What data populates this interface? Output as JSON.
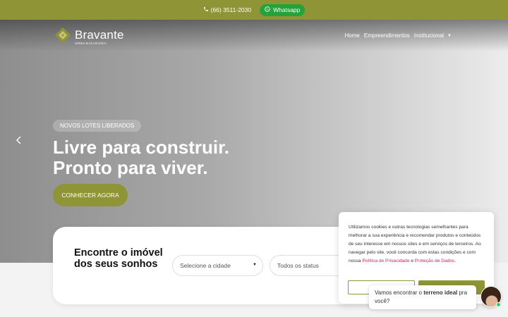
{
  "topbar": {
    "phone": "(66) 3511-2030",
    "whatsapp_label": "Whatsapp",
    "bg_color": "#8f9436",
    "whatsapp_color": "#24a33b"
  },
  "header": {
    "logo_name": "Bravante",
    "logo_sub": "URBANIZADORA",
    "nav": [
      {
        "label": "Home"
      },
      {
        "label": "Empreendimentos"
      },
      {
        "label": "Institucional"
      }
    ]
  },
  "hero": {
    "badge": "NOVOS LOTES LIBERADOS",
    "headline_line1": "Livre para construir.",
    "headline_line2": "Pronto para viver.",
    "cta_label": "CONHECER AGORA",
    "accent_color": "#8f9436"
  },
  "search": {
    "title": "Encontre o imóvel dos seus sonhos",
    "city_placeholder": "Selecione a cidade",
    "status_placeholder": "Todos os status"
  },
  "cookie": {
    "text_before": "Utilizamos cookies e outras tecnologias semelhantes para melhorar a sua experiência e recomendar produtos e conteúdos de seu interesse em nossos sites e em serviços de terceiros. Ao navegar pelo site, você concorda com estas condições e com nossa ",
    "privacy_link": "Política de Privacidade",
    "conjunction": " e ",
    "data_link": "Proteção de Dados",
    "text_after": ".",
    "link_color": "#d4236c"
  },
  "chat": {
    "text_before": "Vamos encontrar o ",
    "text_bold": "terreno ideal",
    "text_after": " pra você?"
  }
}
